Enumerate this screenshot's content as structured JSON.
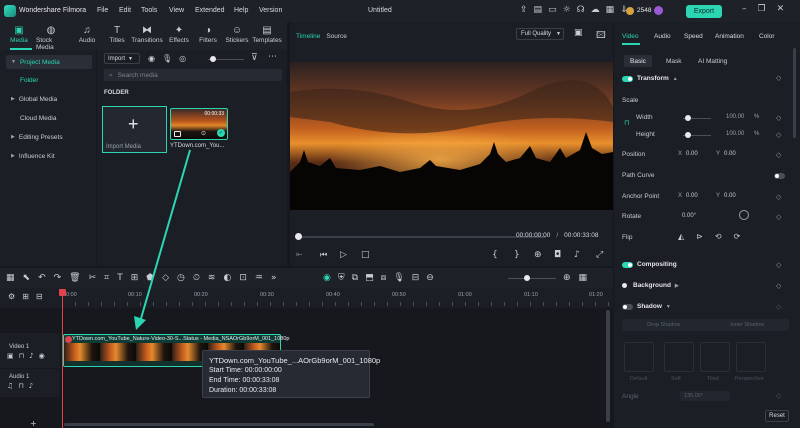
{
  "app": {
    "brand": "Wondershare Filmora",
    "doc_title": "Untitled",
    "credits": "2548",
    "export_label": "Export",
    "menu": [
      "File",
      "Edit",
      "Tools",
      "View",
      "Extended",
      "Help",
      "Version"
    ]
  },
  "lib_tools": [
    {
      "label": "Media",
      "icon": "media-icon"
    },
    {
      "label": "Stock Media",
      "icon": "stock-media-icon"
    },
    {
      "label": "Audio",
      "icon": "audio-icon"
    },
    {
      "label": "Titles",
      "icon": "titles-icon"
    },
    {
      "label": "Transitions",
      "icon": "transitions-icon"
    },
    {
      "label": "Effects",
      "icon": "effects-icon"
    },
    {
      "label": "Filters",
      "icon": "filters-icon"
    },
    {
      "label": "Stickers",
      "icon": "stickers-icon"
    },
    {
      "label": "Templates",
      "icon": "templates-icon"
    }
  ],
  "nav": [
    {
      "label": "Project Media",
      "caret": "▼"
    },
    {
      "label": "Folder",
      "caret": ""
    },
    {
      "label": "Global Media",
      "caret": "▶"
    },
    {
      "label": "Cloud Media",
      "caret": ""
    },
    {
      "label": "Editing Presets",
      "caret": "▶"
    },
    {
      "label": "Influence Kit",
      "caret": "▶"
    }
  ],
  "media": {
    "import_label": "Import",
    "search_placeholder": "Search media",
    "folder_label": "FOLDER",
    "import_card_label": "Import Media",
    "thumb_name": "YTDown.com_You...",
    "thumb_duration": "00:00:33"
  },
  "preview": {
    "tabs": [
      "Timeline",
      "Source"
    ],
    "quality": "Full Quality",
    "current_time": "00:00:00:00",
    "separator": "/",
    "total_time": "00:00:33:08"
  },
  "right": {
    "tabs": [
      "Video",
      "Audio",
      "Speed",
      "Animation",
      "Color"
    ],
    "subtabs": [
      "Basic",
      "Mask",
      "AI Matting"
    ],
    "transform": "Transform",
    "scale": "Scale",
    "width": "Width",
    "width_val": "100.00",
    "height": "Height",
    "height_val": "100.00",
    "pct": "%",
    "position": "Position",
    "pos_x_label": "X",
    "pos_x": "0.00",
    "pos_y_label": "Y",
    "pos_y": "0.00",
    "path_curve": "Path Curve",
    "anchor": "Anchor Point",
    "anc_x": "0.00",
    "anc_y": "0.00",
    "rotate": "Rotate",
    "rotate_val": "0.00°",
    "flip": "Flip",
    "compositing": "Compositing",
    "background": "Background",
    "shadow": "Shadow",
    "drop_shadow": "Drop Shadow",
    "inner_shadow": "Inner Shadow",
    "shadow_types": [
      "Default",
      "Soft",
      "Tiled",
      "Perspective"
    ],
    "angle": "Angle",
    "angle_val": "135.00°",
    "reset": "Reset"
  },
  "ruler": [
    "00:00",
    "00:10",
    "00:20",
    "00:30",
    "00:40",
    "00:50",
    "01:00",
    "01:10",
    "01:20"
  ],
  "tracks": {
    "video": "Video 1",
    "audio": "Audio 1"
  },
  "clip": {
    "name": "YTDown.com_YouTube_Nature-Video-30-S...Status - Media_NSAOrGb9orM_001_1080p"
  },
  "tooltip": {
    "name": "YTDown.com_YouTube_...AOrGb9orM_001_1080p",
    "start": "Start Time: 00:00:00:00",
    "end": "End Time: 00:00:33:08",
    "duration": "Duration: 00:00:33:08"
  },
  "colors": {
    "accent": "#2cd6b2",
    "playhead": "#e0434b"
  }
}
